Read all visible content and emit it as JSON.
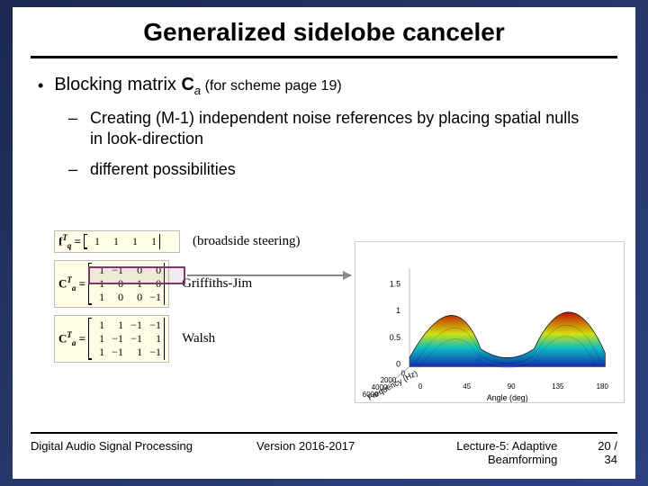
{
  "title": "Generalized sidelobe canceler",
  "bullet1": {
    "lead": "Blocking matrix ",
    "symbol": "C",
    "subscript": "a",
    "paren": " (for scheme page 19)"
  },
  "bullet2a": "Creating (M-1) independent noise references by placing spatial nulls in look-direction",
  "bullet2b": "different possibilities",
  "examples": {
    "row1": {
      "label_main": "f",
      "label_sup": "T",
      "label_sub": "q",
      "vals": [
        "1",
        "1",
        "1",
        "1"
      ],
      "caption": "(broadside steering)"
    },
    "row2": {
      "label_main": "C",
      "label_sup": "T",
      "label_sub": "a",
      "vals": [
        "1",
        "−1",
        "0",
        "0",
        "1",
        "0",
        "−1",
        "0",
        "1",
        "0",
        "0",
        "−1"
      ],
      "caption": "Griffiths-Jim"
    },
    "row3": {
      "label_main": "C",
      "label_sup": "T",
      "label_sub": "a",
      "vals": [
        "1",
        "1",
        "−1",
        "−1",
        "1",
        "−1",
        "−1",
        "1",
        "1",
        "−1",
        "1",
        "−1"
      ],
      "caption": "Walsh"
    }
  },
  "plot": {
    "z_ticks": [
      "0",
      "0.5",
      "1",
      "1.5"
    ],
    "x_label": "Frequency (Hz)",
    "x_ticks": [
      "0",
      "2000",
      "4000",
      "6000"
    ],
    "y_label": "Angle (deg)",
    "y_ticks": [
      "0",
      "45",
      "90",
      "135",
      "180"
    ]
  },
  "footer": {
    "left": "Digital Audio Signal Processing",
    "mid": "Version 2016-2017",
    "right": "Lecture-5: Adaptive Beamforming",
    "page_cur": "20",
    "page_sep": "/",
    "page_tot": "34"
  },
  "chart_data": {
    "type": "heatmap",
    "title": "",
    "xlabel": "Frequency (Hz)",
    "ylabel": "Angle (deg)",
    "zlabel": "",
    "x": [
      0,
      2000,
      4000,
      6000
    ],
    "y": [
      0,
      45,
      90,
      135,
      180
    ],
    "zlim": [
      0,
      1.5
    ],
    "note": "3D surface: spatial response magnitude vs frequency and angle; deep null near 90° (look-direction), peaks toward 0° and 180° increasing with frequency; colormap blue→cyan→yellow→red.",
    "series": []
  }
}
